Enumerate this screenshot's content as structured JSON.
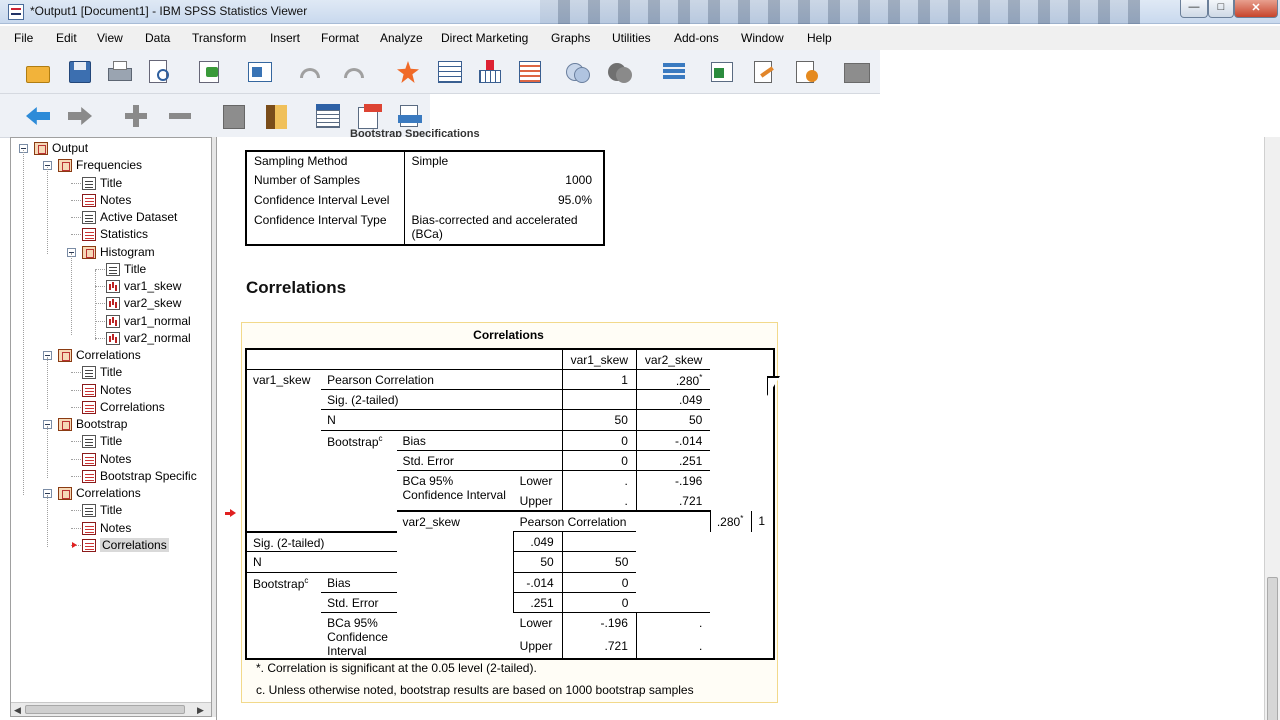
{
  "window": {
    "title": "*Output1 [Document1] - IBM SPSS Statistics Viewer",
    "minimize": "—",
    "maximize": "□",
    "close": "✕"
  },
  "menu": [
    "File",
    "Edit",
    "View",
    "Data",
    "Transform",
    "Insert",
    "Format",
    "Analyze",
    "Direct Marketing",
    "Graphs",
    "Utilities",
    "Add-ons",
    "Window",
    "Help"
  ],
  "toolbar1_icons": [
    "open-icon",
    "save-icon",
    "print-icon",
    "print-preview-icon",
    "export-icon",
    "recall-dialog-icon",
    "undo-icon",
    "redo-icon",
    "goto-data-icon",
    "goto-case-icon",
    "insert-variable-icon",
    "variables-icon",
    "select-cases-icon",
    "value-labels-icon",
    "use-sets-icon",
    "show-all-variables-icon",
    "spelling-icon",
    "designate-window-icon",
    "run-script-icon",
    "disabled-icon"
  ],
  "toolbar2_icons": [
    "back-arrow-icon",
    "forward-arrow-icon",
    "expand-icon",
    "collapse-icon",
    "show-icon",
    "hide-icon",
    "insert-heading-icon",
    "insert-title-icon",
    "insert-text-icon"
  ],
  "outline": [
    {
      "label": "Output",
      "level": 0,
      "icon": "book",
      "expander": true
    },
    {
      "label": "Frequencies",
      "level": 1,
      "icon": "book",
      "expander": true
    },
    {
      "label": "Title",
      "level": 2,
      "icon": "doc"
    },
    {
      "label": "Notes",
      "level": 2,
      "icon": "tbl"
    },
    {
      "label": "Active Dataset",
      "level": 2,
      "icon": "doc"
    },
    {
      "label": "Statistics",
      "level": 2,
      "icon": "tbl"
    },
    {
      "label": "Histogram",
      "level": 2,
      "icon": "book",
      "expander": true
    },
    {
      "label": "Title",
      "level": 3,
      "icon": "doc"
    },
    {
      "label": "var1_skew",
      "level": 3,
      "icon": "chart"
    },
    {
      "label": "var2_skew",
      "level": 3,
      "icon": "chart"
    },
    {
      "label": "var1_normal",
      "level": 3,
      "icon": "chart"
    },
    {
      "label": "var2_normal",
      "level": 3,
      "icon": "chart"
    },
    {
      "label": "Correlations",
      "level": 1,
      "icon": "book",
      "expander": true
    },
    {
      "label": "Title",
      "level": 2,
      "icon": "doc"
    },
    {
      "label": "Notes",
      "level": 2,
      "icon": "tbl"
    },
    {
      "label": "Correlations",
      "level": 2,
      "icon": "tbl"
    },
    {
      "label": "Bootstrap",
      "level": 1,
      "icon": "book",
      "expander": true
    },
    {
      "label": "Title",
      "level": 2,
      "icon": "doc"
    },
    {
      "label": "Notes",
      "level": 2,
      "icon": "tbl"
    },
    {
      "label": "Bootstrap Specific",
      "level": 2,
      "icon": "tbl"
    },
    {
      "label": "Correlations",
      "level": 1,
      "icon": "book",
      "expander": true
    },
    {
      "label": "Title",
      "level": 2,
      "icon": "doc"
    },
    {
      "label": "Notes",
      "level": 2,
      "icon": "tbl"
    },
    {
      "label": "Correlations",
      "level": 2,
      "icon": "tbl",
      "selected": true
    }
  ],
  "content": {
    "cut_title": "Bootstrap Specifications",
    "boot_spec": {
      "rows": [
        {
          "label": "Sampling Method",
          "value": "Simple",
          "align": "left"
        },
        {
          "label": "Number of Samples",
          "value": "1000",
          "align": "right"
        },
        {
          "label": "Confidence Interval Level",
          "value": "95.0%",
          "align": "right"
        },
        {
          "label": "Confidence Interval Type",
          "value": "Bias-corrected and accelerated (BCa)",
          "align": "left"
        }
      ]
    },
    "section_title": "Correlations",
    "table_title": "Correlations",
    "columns": [
      "var1_skew",
      "var2_skew"
    ],
    "var1": {
      "name": "var1_skew",
      "pearson": "Pearson Correlation",
      "pearson_v1": "1",
      "pearson_v2": ".280",
      "sig": "Sig. (2-tailed)",
      "sig_v1": "",
      "sig_v2": ".049",
      "n": "N",
      "n_v1": "50",
      "n_v2": "50",
      "bootstrap": "Bootstrap",
      "bias": "Bias",
      "bias_v1": "0",
      "bias_v2": "-.014",
      "se": "Std. Error",
      "se_v1": "0",
      "se_v2": ".251",
      "ci": "BCa 95% Confidence Interval",
      "lower": "Lower",
      "lower_v1": ".",
      "lower_v2": "-.196",
      "upper": "Upper",
      "upper_v1": ".",
      "upper_v2": ".721"
    },
    "var2": {
      "name": "var2_skew",
      "pearson": "Pearson Correlation",
      "pearson_v1": ".280",
      "pearson_v2": "1",
      "sig": "Sig. (2-tailed)",
      "sig_v1": ".049",
      "sig_v2": "",
      "n": "N",
      "n_v1": "50",
      "n_v2": "50",
      "bootstrap": "Bootstrap",
      "bias": "Bias",
      "bias_v1": "-.014",
      "bias_v2": "0",
      "se": "Std. Error",
      "se_v1": ".251",
      "se_v2": "0",
      "ci": "BCa 95% Confidence Interval",
      "lower": "Lower",
      "lower_v1": "-.196",
      "lower_v2": ".",
      "upper": "Upper",
      "upper_v1": ".721",
      "upper_v2": "."
    },
    "sup_star": "*",
    "sup_c": "c",
    "footnote1": "*. Correlation is significant at the 0.05 level (2-tailed).",
    "footnote2": "c. Unless otherwise noted, bootstrap results are based on 1000 bootstrap samples"
  },
  "colors": {
    "accent_red": "#e02020",
    "selection_border": "#f2d98b"
  }
}
